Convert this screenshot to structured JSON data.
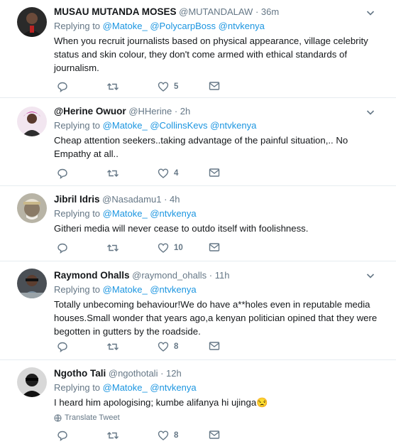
{
  "tweets": [
    {
      "name": "MUSAU MUTANDA MOSES",
      "handle": "@MUTANDALAW",
      "time": "36m",
      "replying_label": "Replying to",
      "mentions": [
        "@Matoke_",
        "@PolycarpBoss",
        "@ntvkenya"
      ],
      "text": "When you recruit journalists based on physical appearance, village celebrity status and skin colour,  they don't come armed with ethical standards of journalism.",
      "likes": "5"
    },
    {
      "name": "@Herine Owuor",
      "handle": "@HHerine",
      "time": "2h",
      "replying_label": "Replying to",
      "mentions": [
        "@Matoke_",
        "@CollinsKevs",
        "@ntvkenya"
      ],
      "text": "Cheap attention seekers..taking advantage of the painful situation,.. No Empathy at all..",
      "likes": "4"
    },
    {
      "name": "Jibril Idris",
      "handle": "@Nasadamu1",
      "time": "4h",
      "replying_label": "Replying to",
      "mentions": [
        "@Matoke_",
        "@ntvkenya"
      ],
      "text": "Githeri media will never cease to outdo itself with foolishness.",
      "likes": "10"
    },
    {
      "name": "Raymond Ohalls",
      "handle": "@raymond_ohalls",
      "time": "11h",
      "replying_label": "Replying to",
      "mentions": [
        "@Matoke_",
        "@ntvkenya"
      ],
      "text": "Totally unbecoming behaviour!We do have a**holes even in reputable media houses.Small wonder that years ago,a kenyan politician opined that they were begotten in gutters by the roadside.",
      "likes": "8"
    },
    {
      "name": "Ngotho Tali",
      "handle": "@ngothotali",
      "time": "12h",
      "replying_label": "Replying to",
      "mentions": [
        "@Matoke_",
        "@ntvkenya"
      ],
      "text": "I heard him apologising; kumbe alifanya hi ujinga😒",
      "translate_label": "Translate Tweet",
      "likes": "8"
    }
  ],
  "separator": "·",
  "colors": {
    "link": "#1b95e0",
    "muted": "#657786",
    "text": "#14171a",
    "border": "#e6ecf0"
  }
}
